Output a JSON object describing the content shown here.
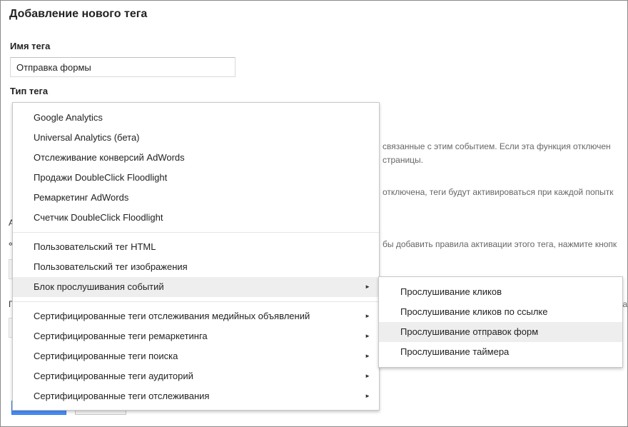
{
  "page": {
    "title": "Добавление нового тега",
    "tag_name_label": "Имя тега",
    "tag_name_value": "Отправка формы",
    "tag_type_label": "Тип тега"
  },
  "background": {
    "line1": "связанные с этим событием. Если эта функция отключен",
    "line2": "страницы.",
    "line3": "отключена, теги будут активироваться при каждой попытк",
    "line4": "бы добавить правила активации этого тега, нажмите кнопк",
    "line5": "ка",
    "stub1": "А",
    "stub2": "«",
    "stub3": "Г"
  },
  "main_menu": {
    "group1": [
      {
        "label": "Google Analytics"
      },
      {
        "label": "Universal Analytics (бета)"
      },
      {
        "label": "Отслеживание конверсий AdWords"
      },
      {
        "label": "Продажи DoubleClick Floodlight"
      },
      {
        "label": "Ремаркетинг AdWords"
      },
      {
        "label": "Счетчик DoubleClick Floodlight"
      }
    ],
    "group2": [
      {
        "label": "Пользовательский тег HTML"
      },
      {
        "label": "Пользовательский тег изображения"
      },
      {
        "label": "Блок прослушивания событий",
        "arrow": "►"
      }
    ],
    "group3": [
      {
        "label": "Сертифицированные теги отслеживания медийных объявлений",
        "arrow": "►"
      },
      {
        "label": "Сертифицированные теги ремаркетинга",
        "arrow": "►"
      },
      {
        "label": "Сертифицированные теги поиска",
        "arrow": "►"
      },
      {
        "label": "Сертифицированные теги аудиторий",
        "arrow": "►"
      },
      {
        "label": "Сертифицированные теги отслеживания",
        "arrow": "►"
      }
    ]
  },
  "sub_menu": [
    {
      "label": "Прослушивание кликов"
    },
    {
      "label": "Прослушивание кликов по ссылке"
    },
    {
      "label": "Прослушивание отправок форм"
    },
    {
      "label": "Прослушивание таймера"
    }
  ],
  "colors": {
    "highlight": "#eeeeee",
    "primary_button": "#4d90fe"
  }
}
